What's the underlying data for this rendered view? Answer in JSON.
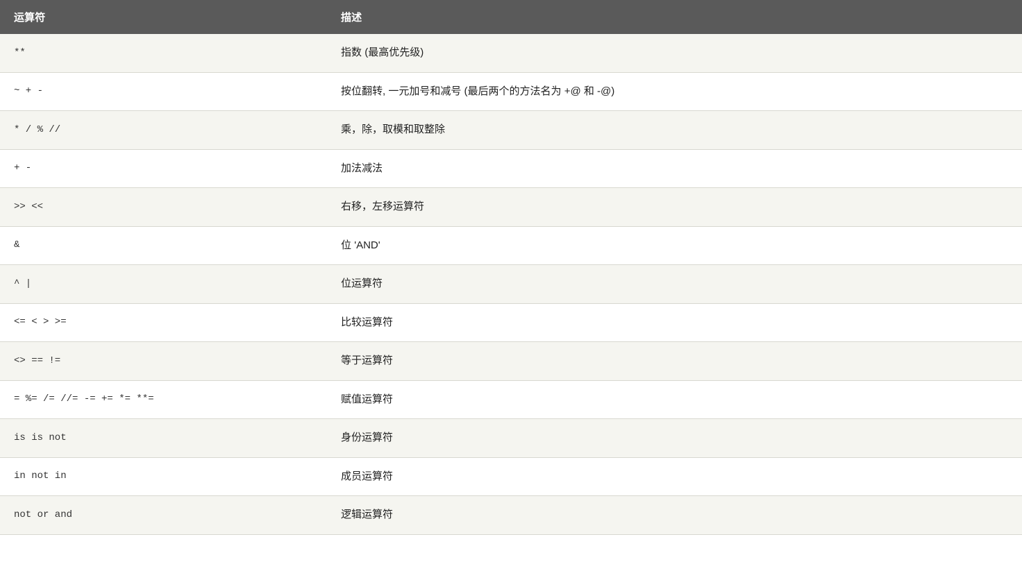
{
  "table": {
    "headers": [
      {
        "key": "operator",
        "label": "运算符"
      },
      {
        "key": "description",
        "label": "描述"
      }
    ],
    "rows": [
      {
        "operator": "**",
        "description": "指数 (最高优先级)"
      },
      {
        "operator": "~ + -",
        "description": "按位翻转, 一元加号和减号 (最后两个的方法名为 +@ 和 -@)"
      },
      {
        "operator": "* / % //",
        "description": "乘，除，取模和取整除"
      },
      {
        "operator": "+ -",
        "description": "加法减法"
      },
      {
        "operator": ">> <<",
        "description": "右移，左移运算符"
      },
      {
        "operator": "&",
        "description": "位 'AND'"
      },
      {
        "operator": "^ |",
        "description": "位运算符"
      },
      {
        "operator": "<= < > >=",
        "description": "比较运算符"
      },
      {
        "operator": "<> == !=",
        "description": "等于运算符"
      },
      {
        "operator": "= %= /= //= -= += *= **=",
        "description": "赋值运算符"
      },
      {
        "operator": "is is not",
        "description": "身份运算符"
      },
      {
        "operator": "in not in",
        "description": "成员运算符"
      },
      {
        "operator": "not or and",
        "description": "逻辑运算符"
      }
    ]
  }
}
